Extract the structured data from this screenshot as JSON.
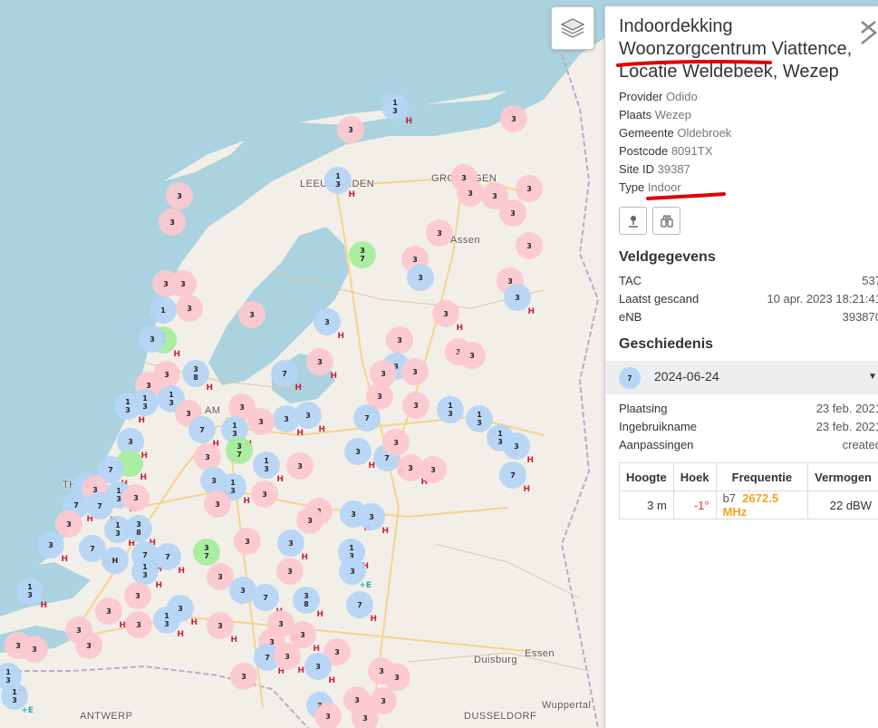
{
  "map": {
    "cities": {
      "leeuwarden": "LEEUWARDEN",
      "groningen": "GRONINGEN",
      "assen": "Assen",
      "amsterdam": "AM",
      "antwerp": "ANTWERP",
      "dusseldorf": "DUSSELDORF",
      "duisburg": "Duisburg",
      "essen": "Essen",
      "wuppertal": "Wuppertal",
      "th": "TH"
    },
    "marker_colors": {
      "pink": "#fdc9cf",
      "blue": "#b5d6f7",
      "green": "#a6ee9d",
      "h_mark": "#c8102e",
      "e_mark": "#1ba6a6"
    },
    "h_label": "H",
    "e_label": "+E"
  },
  "layer_button": {
    "icon": "layers-icon"
  },
  "panel": {
    "title_line1": "Indoordekking",
    "title_line2": "Woonzorgcentrum Viattence,",
    "title_line3": "Locatie Weldebeek, Wezep",
    "props": [
      {
        "label": "Provider",
        "value": "Odido"
      },
      {
        "label": "Plaats",
        "value": "Wezep"
      },
      {
        "label": "Gemeente",
        "value": "Oldebroek"
      },
      {
        "label": "Postcode",
        "value": "8091TX"
      },
      {
        "label": "Site ID",
        "value": "39387"
      },
      {
        "label": "Type",
        "value": "Indoor"
      }
    ],
    "buttons": {
      "pin": "pin-icon",
      "binoculars": "binoculars-icon"
    },
    "veld_heading": "Veldgegevens",
    "veld": [
      {
        "label": "TAC",
        "value": "537"
      },
      {
        "label": "Laatst gescand",
        "value": "10 apr. 2023 18:21:41"
      },
      {
        "label": "eNB",
        "value": "393870"
      }
    ],
    "history_heading": "Geschiedenis",
    "history_entry": {
      "badge": "7",
      "date": "2024-06-24"
    },
    "history_details": [
      {
        "label": "Plaatsing",
        "value": "23 feb. 2021"
      },
      {
        "label": "Ingebruikname",
        "value": "23 feb. 2021"
      },
      {
        "label": "Aanpassingen",
        "value": "created"
      }
    ],
    "table": {
      "headers": [
        "Hoogte",
        "Hoek",
        "Frequentie",
        "Vermogen"
      ],
      "row": {
        "hoogte": "3 m",
        "hoek": "-1°",
        "band": "b7",
        "freq": "2672.5 MHz",
        "vermogen": "22 dBW"
      }
    },
    "colors": {
      "hoek": "#e53935",
      "freq": "#f2a51a",
      "underline": "#e00000"
    }
  }
}
